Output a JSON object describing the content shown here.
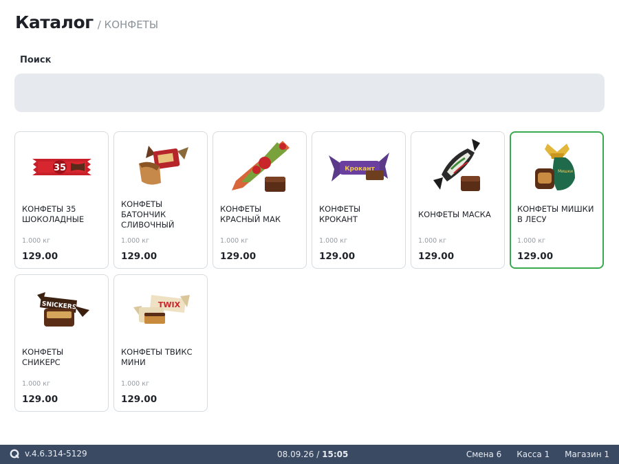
{
  "header": {
    "title": "Каталог",
    "breadcrumb": "/ КОНФЕТЫ"
  },
  "search": {
    "label": "Поиск",
    "value": "",
    "placeholder": ""
  },
  "products": [
    {
      "name": "КОНФЕТЫ 35 ШОКОЛАДНЫЕ",
      "weight": "1.000 кг",
      "price": "129.00",
      "image": "candy-35-bar",
      "selected": false
    },
    {
      "name": "КОНФЕТЫ БАТОНЧИК СЛИВОЧНЫЙ",
      "weight": "1.000 кг",
      "price": "129.00",
      "image": "candy-batonchik",
      "selected": false
    },
    {
      "name": "КОНФЕТЫ КРАСНЫЙ МАК",
      "weight": "1.000 кг",
      "price": "129.00",
      "image": "candy-krasny-mak",
      "selected": false
    },
    {
      "name": "КОНФЕТЫ КРОКАНТ",
      "weight": "1.000 кг",
      "price": "129.00",
      "image": "candy-krokant",
      "selected": false
    },
    {
      "name": "КОНФЕТЫ МАСКА",
      "weight": "1.000 кг",
      "price": "129.00",
      "image": "candy-maska",
      "selected": false
    },
    {
      "name": "КОНФЕТЫ МИШКИ В ЛЕСУ",
      "weight": "1.000 кг",
      "price": "129.00",
      "image": "candy-mishki",
      "selected": true
    },
    {
      "name": "КОНФЕТЫ СНИКЕРС",
      "weight": "1.000 кг",
      "price": "129.00",
      "image": "candy-snickers",
      "selected": false
    },
    {
      "name": "КОНФЕТЫ ТВИКС МИНИ",
      "weight": "1.000 кг",
      "price": "129.00",
      "image": "candy-twix",
      "selected": false
    }
  ],
  "statusbar": {
    "version": "v.4.6.314-5129",
    "date": "08.09.26",
    "separator": "/",
    "time": "15:05",
    "shift": "Смена 6",
    "register": "Касса 1",
    "store": "Магазин 1"
  },
  "colors": {
    "accent_selected": "#3aa94e",
    "statusbar_bg": "#3a4a63",
    "search_bg": "#e6eaef"
  }
}
